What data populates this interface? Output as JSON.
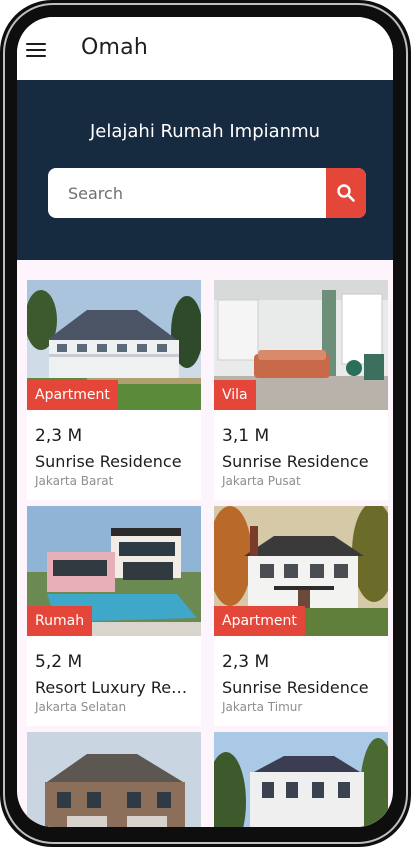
{
  "app": {
    "title": "Omah"
  },
  "hero": {
    "title": "Jelajahi Rumah Impianmu",
    "search_placeholder": "Search"
  },
  "listings": [
    {
      "tag": "Apartment",
      "price": "2,3 M",
      "name": "Sunrise Residence",
      "location": "Jakarta Barat"
    },
    {
      "tag": "Vila",
      "price": "3,1 M",
      "name": "Sunrise Residence",
      "location": "Jakarta Pusat"
    },
    {
      "tag": "Rumah",
      "price": "5,2 M",
      "name": "Resort Luxury Residence",
      "location": "Jakarta Selatan"
    },
    {
      "tag": "Apartment",
      "price": "2,3 M",
      "name": "Sunrise Residence",
      "location": "Jakarta Timur"
    }
  ],
  "colors": {
    "accent": "#e4473a",
    "hero_bg": "#162a40",
    "page_bg": "#fdf5fb"
  }
}
